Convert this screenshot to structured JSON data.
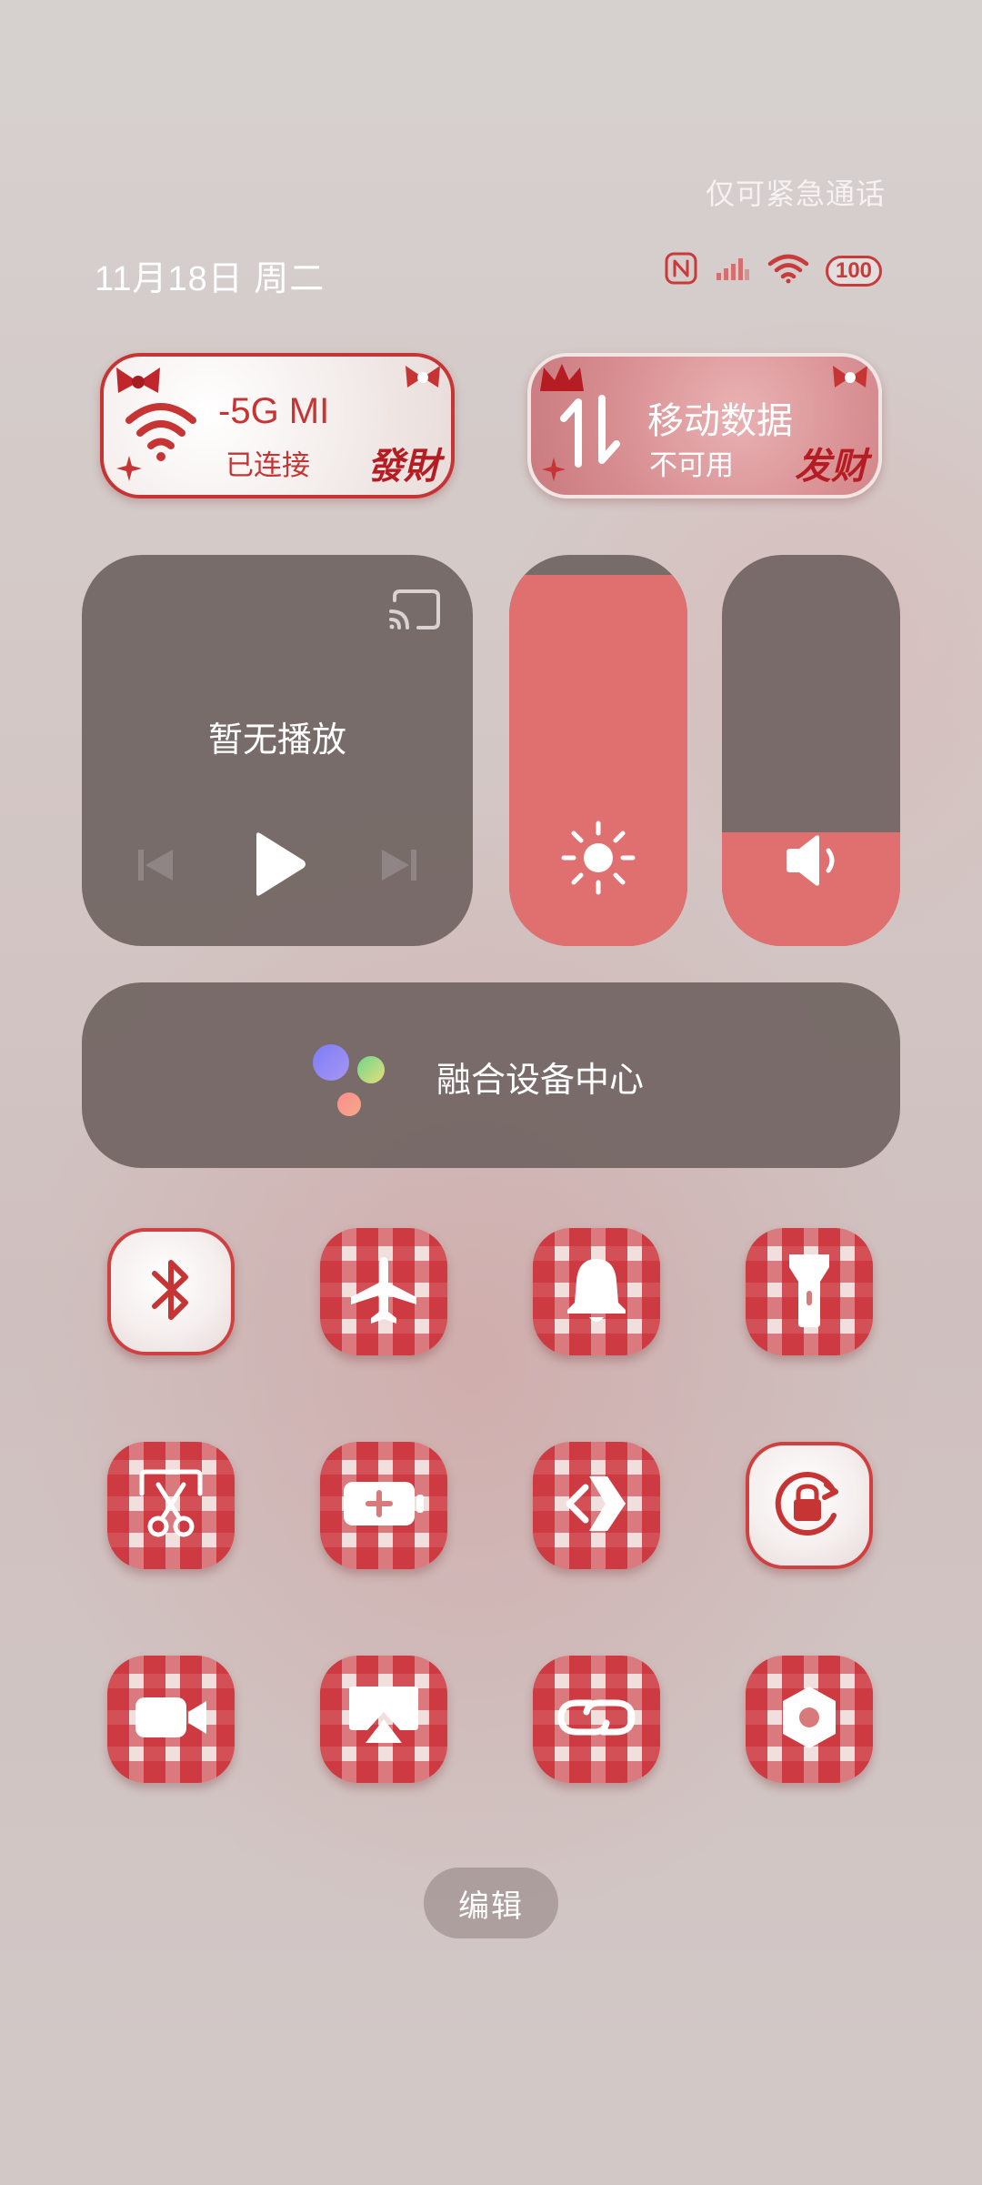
{
  "status_bar": {
    "emergency_text": "仅可紧急通话",
    "date_text": "11月18日 周二",
    "battery": "100",
    "icons": [
      "nfc-icon",
      "signal-icon",
      "wifi-icon",
      "battery-icon"
    ]
  },
  "wifi_tile": {
    "ssid": "-5G   MI",
    "status": "已连接",
    "decor_text": "發財"
  },
  "data_tile": {
    "title": "移动数据",
    "status": "不可用",
    "decor_text": "发财"
  },
  "media": {
    "status_text": "暂无播放"
  },
  "sliders": {
    "brightness_level": 0.95,
    "volume_level": 0.29
  },
  "device_center": {
    "label": "融合设备中心"
  },
  "toggles": [
    {
      "name": "bluetooth",
      "active": true
    },
    {
      "name": "airplane-mode",
      "active": false
    },
    {
      "name": "ring-mode",
      "active": false
    },
    {
      "name": "flashlight",
      "active": false
    },
    {
      "name": "screenshot",
      "active": false
    },
    {
      "name": "battery-saver",
      "active": false
    },
    {
      "name": "nearby-share",
      "active": false
    },
    {
      "name": "rotation-lock",
      "active": true
    },
    {
      "name": "screen-record",
      "active": false
    },
    {
      "name": "screen-cast",
      "active": false
    },
    {
      "name": "link-share",
      "active": false
    },
    {
      "name": "settings",
      "active": false
    }
  ],
  "edit_label": "编辑",
  "colors": {
    "accent_red": "#c73434",
    "slider_fill": "#e07070",
    "card_gray": "#706462"
  }
}
